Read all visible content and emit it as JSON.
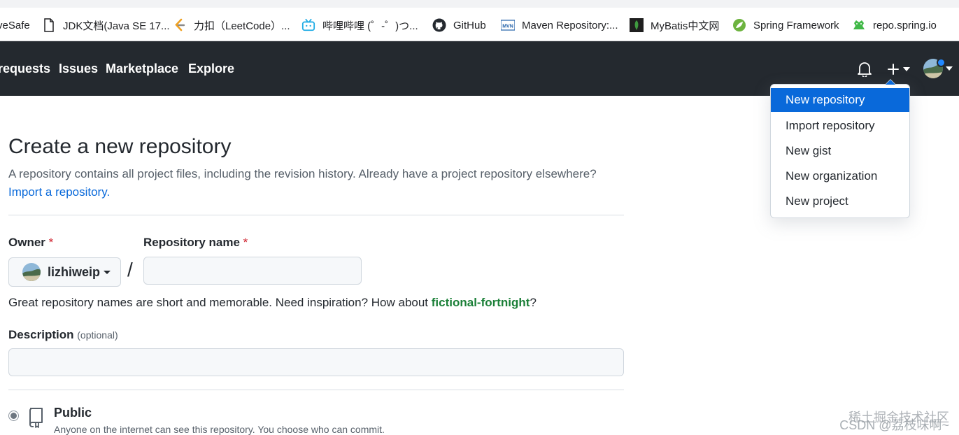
{
  "bookmarks": [
    {
      "label": "veSafe",
      "icon": "none"
    },
    {
      "label": "JDK文档(Java SE 17...",
      "icon": "document-icon"
    },
    {
      "label": "力扣（LeetCode）...",
      "icon": "leetcode-icon"
    },
    {
      "label": "哔哩哔哩 (゜-゜)つ...",
      "icon": "bilibili-icon"
    },
    {
      "label": "GitHub",
      "icon": "github-icon"
    },
    {
      "label": "Maven Repository:...",
      "icon": "maven-icon"
    },
    {
      "label": "MyBatis中文网",
      "icon": "mybatis-icon"
    },
    {
      "label": "Spring Framework",
      "icon": "spring-icon"
    },
    {
      "label": "repo.spring.io",
      "icon": "frog-icon"
    }
  ],
  "header": {
    "nav": [
      "requests",
      "Issues",
      "Marketplace",
      "Explore"
    ]
  },
  "dropdown": {
    "items": [
      {
        "label": "New repository",
        "active": true
      },
      {
        "label": "Import repository",
        "active": false
      },
      {
        "label": "New gist",
        "active": false
      },
      {
        "label": "New organization",
        "active": false
      },
      {
        "label": "New project",
        "active": false
      }
    ]
  },
  "main": {
    "title": "Create a new repository",
    "subtitle": "A repository contains all project files, including the revision history. Already have a project repository elsewhere?",
    "import_link": "Import a repository.",
    "owner_label": "Owner",
    "required_mark": "*",
    "owner_value": "lizhiweip",
    "slash": "/",
    "repo_name_label": "Repository name",
    "repo_name_value": "",
    "hint_text": "Great repository names are short and memorable. Need inspiration? How about ",
    "suggestion": "fictional-fortnight",
    "hint_end": "?",
    "description_label": "Description",
    "optional_label": "(optional)",
    "description_value": "",
    "visibility": {
      "title": "Public",
      "description": "Anyone on the internet can see this repository. You choose who can commit."
    }
  },
  "watermark": {
    "line1": "稀土掘金技术社区",
    "line2": "CSDN @荔枝味啊~"
  },
  "colors": {
    "header_bg": "#24292f",
    "accent": "#0969da",
    "success": "#1a7f37",
    "danger": "#cf222e"
  }
}
